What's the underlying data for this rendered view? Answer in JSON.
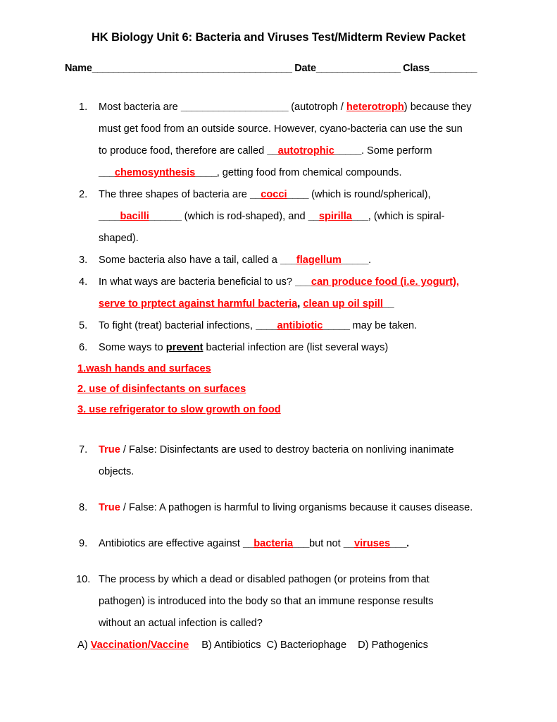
{
  "document": {
    "title": "HK Biology Unit 6: Bacteria and Viruses Test/Midterm Review Packet",
    "answer_color": "#ff0000",
    "text_color": "#000000",
    "background_color": "#ffffff"
  },
  "header": {
    "name_label": "Name",
    "name_blank": "______________________________________",
    "date_label": "Date",
    "date_blank": "________________",
    "class_label": "Class",
    "class_blank": "_________"
  },
  "questions": {
    "q1": {
      "number": "1.",
      "line1_a": "Most bacteria are ",
      "line1_blank": "____________________",
      "line1_b": " (autotroph / ",
      "line1_answer": "heterotroph",
      "line1_c": ") because they",
      "line2": "must get food from an outside source. However, cyano-bacteria can use the sun",
      "line3_a": "to produce food, therefore are called ",
      "line3_blank_pre": "__",
      "line3_answer": "autotrophic",
      "line3_blank_post": "_____",
      "line3_b": ". Some perform",
      "line4_blank_pre": "___",
      "line4_answer": "chemosynthesis",
      "line4_blank_post": "____",
      "line4_b": ", getting food from chemical compounds."
    },
    "q2": {
      "number": "2.",
      "line1_a": "The three shapes of bacteria are ",
      "line1_blank_pre": "__",
      "line1_answer": "cocci",
      "line1_blank_post": "____",
      "line1_b": " (which is round/spherical),",
      "line2_blank_pre": "____",
      "line2_answer": "bacilli",
      "line2_blank_post": "______",
      "line2_a": " (which is rod-shaped), and ",
      "line2_blank_pre2": "__",
      "line2_answer2": "spirilla",
      "line2_blank_post2": "___",
      "line2_b": ", (which is spiral-",
      "line3": "shaped)."
    },
    "q3": {
      "number": "3.",
      "line1_a": "Some bacteria also have a tail, called a ",
      "line1_blank_pre": "___",
      "line1_answer": "flagellum",
      "line1_blank_post": "_____",
      "line1_b": "."
    },
    "q4": {
      "number": "4.",
      "line1_a": "In what ways are bacteria beneficial to us? ",
      "line1_blank_pre": "___",
      "line1_answer": "can produce food (i.e. yogurt),",
      "line2_answer_a": "serve to prptect against harmful bacteria",
      "line2_sep": ",",
      "line2_answer_b": "clean up oil spill",
      "line2_blank_post": "__"
    },
    "q5": {
      "number": "5.",
      "line1_a": "To fight (treat) bacterial infections, ",
      "line1_blank_pre": "____",
      "line1_answer": "antibiotic",
      "line1_blank_post": "_____",
      "line1_b": " may be taken."
    },
    "q6": {
      "number": "6.",
      "line1_a": "Some ways to ",
      "line1_bold": "prevent",
      "line1_b": " bacterial infection are (list several ways)",
      "answers": [
        "1.wash hands and surfaces",
        "2. use of disinfectants on surfaces",
        "3. use refrigerator to slow growth on food"
      ]
    },
    "q7": {
      "number": "7.",
      "answer": "True",
      "line1_a": " / False: Disinfectants are used to destroy bacteria on nonliving inanimate",
      "line2": "objects."
    },
    "q8": {
      "number": "8.",
      "answer": "True",
      "line1_a": " / False: A pathogen is harmful to living organisms because it causes disease."
    },
    "q9": {
      "number": "9.",
      "line1_a": "Antibiotics are effective against ",
      "line1_blank_pre": "__",
      "line1_answer": "bacteria",
      "line1_blank_post": "___",
      "line1_b": "but not ",
      "line1_blank_pre2": "__",
      "line1_answer2": "viruses",
      "line1_blank_post2": "___",
      "line1_c": "."
    },
    "q10": {
      "number": "10.",
      "line1": "The process by which a dead or disabled pathogen (or proteins from that",
      "line2": "pathogen) is introduced into the body so that an immune response results",
      "line3": "without an actual infection is called?",
      "choices": {
        "a_label": "A) ",
        "a_text": "Vaccination/Vaccine",
        "b_text": "B) Antibiotics",
        "c_text": "C) Bacteriophage",
        "d_text": "D) Pathogenics"
      }
    }
  }
}
